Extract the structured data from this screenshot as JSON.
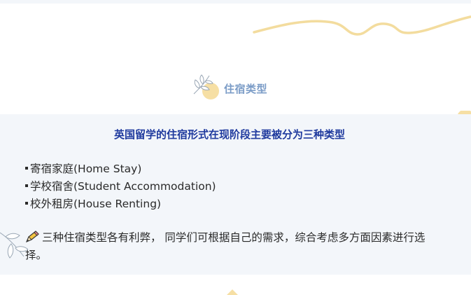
{
  "section": {
    "heading": "住宿类型"
  },
  "panel": {
    "title": "英国留学的住宿形式在现阶段主要被分为三种类型",
    "items": [
      {
        "label": "寄宿家庭(Home Stay)"
      },
      {
        "label": "学校宿舍(Student Accommodation)"
      },
      {
        "label": "校外租房(House Renting)"
      }
    ],
    "note": "三种住宿类型各有利弊， 同学们可根据自己的需求，综合考虑多方面因素进行选择。"
  },
  "icons": {
    "heading_decoration": "leaf-icon",
    "note_marker": "pencil-icon",
    "corner_leaves": "leaf-icon"
  },
  "colors": {
    "heading": "#7b9cc7",
    "title": "#1f3a9e",
    "panel_background": "#f3f6fa",
    "accent_yellow": "#f6dfa4"
  }
}
